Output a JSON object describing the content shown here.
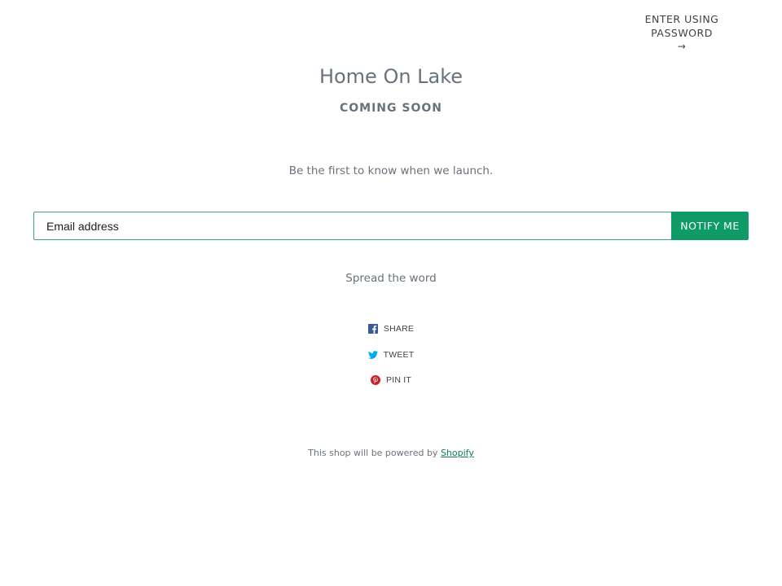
{
  "header": {
    "enter_password_label": "ENTER USING PASSWORD",
    "enter_arrow": "→"
  },
  "shop": {
    "title": "Home On Lake",
    "subtitle": "COMING SOON",
    "tagline": "Be the first to know when we launch."
  },
  "signup": {
    "email_placeholder": "Email address",
    "email_value": "",
    "button_label": "NOTIFY ME"
  },
  "share": {
    "heading": "Spread the word",
    "items": [
      {
        "label": "SHARE",
        "icon": "facebook-icon",
        "color": "#3b5998"
      },
      {
        "label": "TWEET",
        "icon": "twitter-icon",
        "color": "#00aced"
      },
      {
        "label": "PIN IT",
        "icon": "pinterest-icon",
        "color": "#cb2027"
      }
    ]
  },
  "footer": {
    "text": "This shop will be powered by ",
    "link_label": "Shopify"
  },
  "colors": {
    "accent": "#0f9b67",
    "input_border": "#3ea571",
    "text_muted": "#69727b"
  }
}
